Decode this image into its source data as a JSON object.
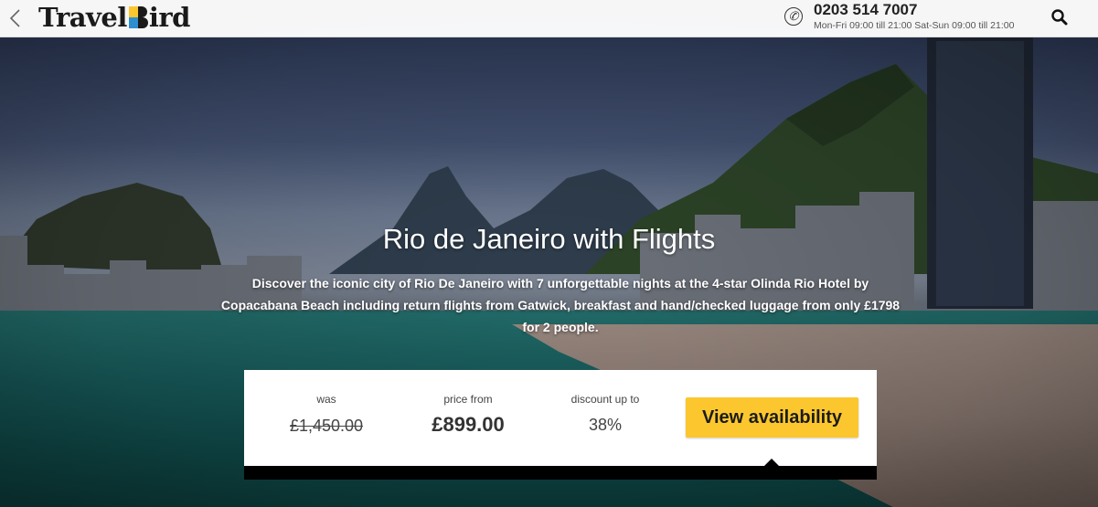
{
  "header": {
    "logo_text_left": "Travel",
    "logo_text_right": "ird",
    "phone_number": "0203 514 7007",
    "phone_hours": "Mon-Fri 09:00 till 21:00 Sat-Sun 09:00 till 21:00"
  },
  "hero": {
    "title": "Rio de Janeiro with Flights",
    "description": "Discover the iconic city of Rio De Janeiro with 7 unforgettable nights at the 4-star Olinda Rio Hotel by Copacabana Beach including return flights from Gatwick, breakfast and hand/checked luggage from only £1798 for 2 people."
  },
  "pricing": {
    "was_label": "was",
    "was_value": "£1,450.00",
    "price_label": "price from",
    "price_value": "£899.00",
    "discount_label": "discount up to",
    "discount_value": "38%",
    "cta_label": "View availability"
  },
  "colors": {
    "cta": "#fcc72e",
    "logo_blue": "#2d8fd0",
    "logo_yellow": "#fcc72e"
  },
  "icons": [
    "chevron-left-icon",
    "phone-icon",
    "search-icon"
  ]
}
